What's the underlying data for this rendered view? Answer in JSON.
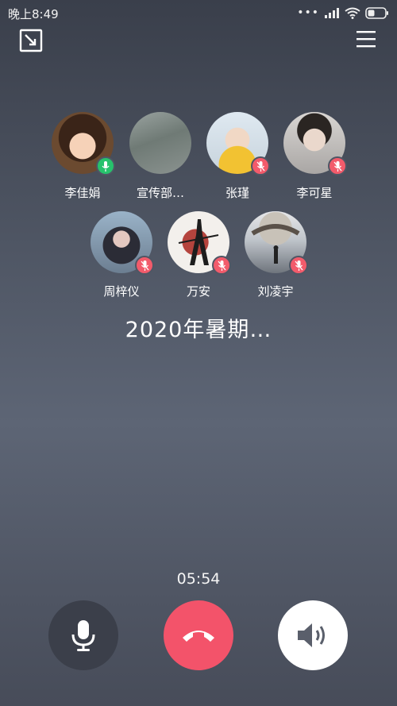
{
  "status_bar": {
    "time": "晚上8:49",
    "signal_dots": "•••"
  },
  "participants": [
    {
      "name": "李佳娟",
      "mic": "on"
    },
    {
      "name": "宣传部…",
      "mic": "none"
    },
    {
      "name": "张瑾",
      "mic": "off"
    },
    {
      "name": "李可星",
      "mic": "off"
    },
    {
      "name": "周梓仪",
      "mic": "off"
    },
    {
      "name": "万安",
      "mic": "off"
    },
    {
      "name": "刘凌宇",
      "mic": "off"
    }
  ],
  "call": {
    "title": "2020年暑期…",
    "timer": "05:54"
  },
  "colors": {
    "mic_on": "#27c26c",
    "mic_off": "#f25b6b",
    "hangup": "#f3536a"
  }
}
